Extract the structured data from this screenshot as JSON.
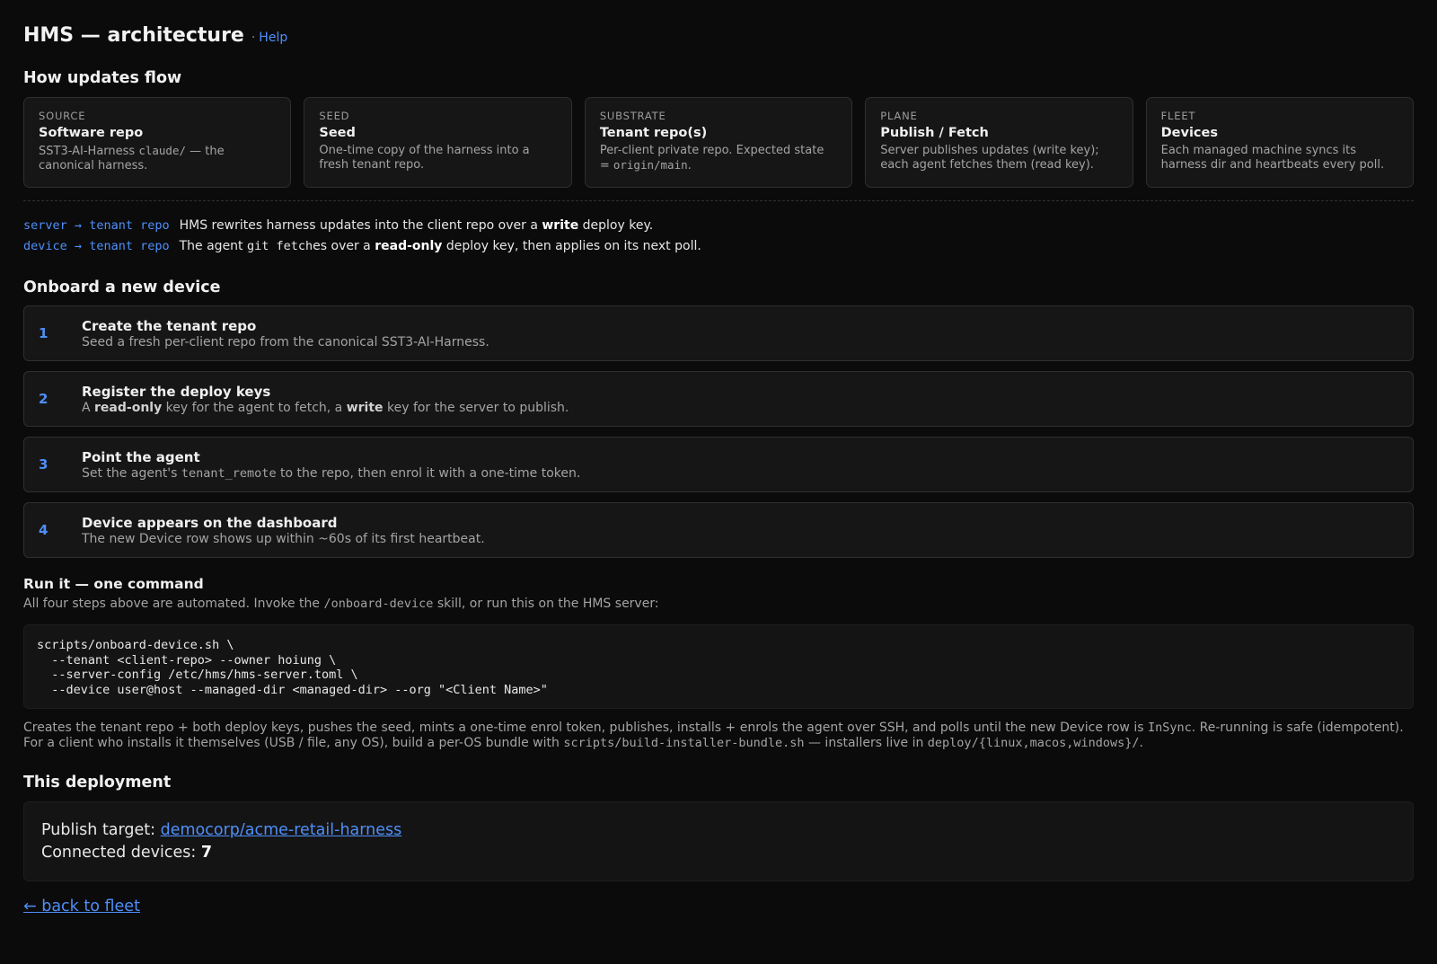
{
  "header": {
    "title": "HMS — architecture",
    "separator": "·",
    "help_label": "Help"
  },
  "flow": {
    "heading": "How updates flow",
    "cards": [
      {
        "eyebrow": "SOURCE",
        "title": "Software repo",
        "desc_pre": "SST3-AI-Harness ",
        "desc_code": "claude/",
        "desc_post": " — the canonical harness."
      },
      {
        "eyebrow": "SEED",
        "title": "Seed",
        "desc_pre": "One-time copy of the harness into a fresh tenant repo.",
        "desc_code": "",
        "desc_post": ""
      },
      {
        "eyebrow": "SUBSTRATE",
        "title": "Tenant repo(s)",
        "desc_pre": "Per-client private repo. Expected state = ",
        "desc_code": "origin/main",
        "desc_post": "."
      },
      {
        "eyebrow": "PLANE",
        "title": "Publish / Fetch",
        "desc_pre": "Server publishes updates (write key); each agent fetches them (read key).",
        "desc_code": "",
        "desc_post": ""
      },
      {
        "eyebrow": "FLEET",
        "title": "Devices",
        "desc_pre": "Each managed machine syncs its harness dir and heartbeats every poll.",
        "desc_code": "",
        "desc_post": ""
      }
    ],
    "lines": [
      {
        "from": "server",
        "arrow": "→",
        "to": "tenant repo",
        "t1": "HMS rewrites harness updates into the client repo over a ",
        "code": "",
        "t2": "",
        "bold": "write",
        "t3": " deploy key."
      },
      {
        "from": "device",
        "arrow": "→",
        "to": "tenant repo",
        "t1": "The agent ",
        "code": "git fetch",
        "t2": "es over a ",
        "bold": "read-only",
        "t3": " deploy key, then applies on its next poll."
      }
    ]
  },
  "onboard": {
    "heading": "Onboard a new device",
    "steps": [
      {
        "num": "1",
        "title": "Create the tenant repo",
        "desc": "Seed a fresh per-client repo from the canonical SST3-AI-Harness."
      },
      {
        "num": "2",
        "title": "Register the deploy keys",
        "d1": "A ",
        "b1": "read-only",
        "d2": " key for the agent to fetch, a ",
        "b2": "write",
        "d3": " key for the server to publish."
      },
      {
        "num": "3",
        "title": "Point the agent",
        "d1": "Set the agent's ",
        "code": "tenant_remote",
        "d2": " to the repo, then enrol it with a one-time token."
      },
      {
        "num": "4",
        "title": "Device appears on the dashboard",
        "desc": "The new Device row shows up within ~60s of its first heartbeat."
      }
    ]
  },
  "run": {
    "title": "Run it — one command",
    "d1": "All four steps above are automated. Invoke the ",
    "code": "/onboard-device",
    "d2": " skill, or run this on the HMS server:",
    "command": "scripts/onboard-device.sh \\\n  --tenant <client-repo> --owner hoiung \\\n  --server-config /etc/hms/hms-server.toml \\\n  --device user@host --managed-dir <managed-dir> --org \"<Client Name>\"",
    "n1": "Creates the tenant repo + both deploy keys, pushes the seed, mints a one-time enrol token, publishes, installs + enrols the agent over SSH, and polls until the new Device row is ",
    "n_code1": "InSync",
    "n2": ". Re-running is safe (idempotent). For a client who installs it themselves (USB / file, any OS), build a per-OS bundle with ",
    "n_code2": "scripts/build-installer-bundle.sh",
    "n3": " — installers live in ",
    "n_code3": "deploy/{linux,macos,windows}/",
    "n4": "."
  },
  "deployment": {
    "heading": "This deployment",
    "target_label": "Publish target: ",
    "target_value": "democorp/acme-retail-harness",
    "devices_label": "Connected devices: ",
    "devices_value": "7"
  },
  "footer": {
    "back_label": "← back to fleet"
  },
  "colors": {
    "background": "#0b0b0c",
    "card": "#161617",
    "accent": "#4f8ff7"
  }
}
